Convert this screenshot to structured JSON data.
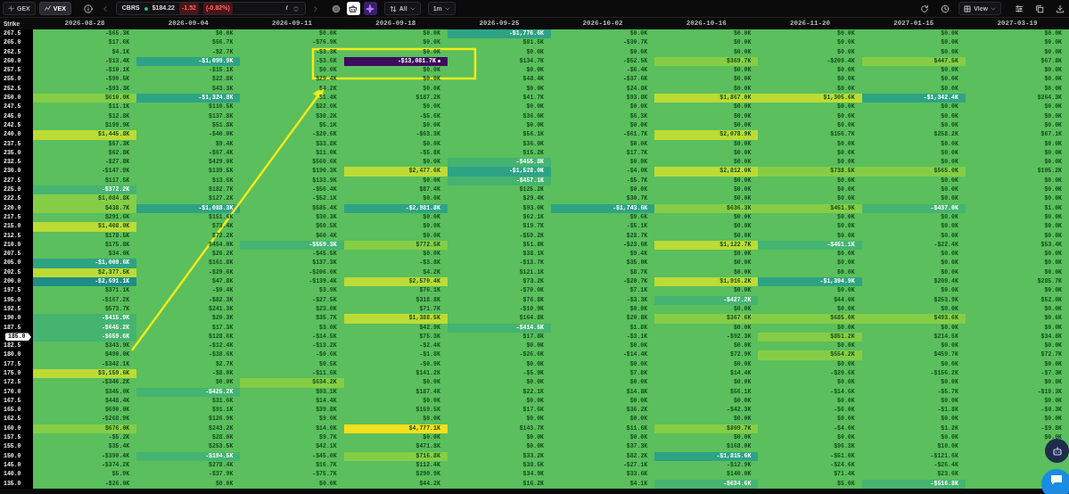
{
  "toolbar": {
    "modes": [
      {
        "label": "GEX",
        "selected": false
      },
      {
        "label": "VEX",
        "selected": true
      }
    ],
    "ticker": {
      "symbol": "CBRS",
      "price": "$184.22",
      "change": "-1.52",
      "change_pct": "(-0.82%)",
      "separator": "/"
    },
    "filter": "All",
    "interval": "1m",
    "view": "View"
  },
  "table": {
    "strike_header": "Strike",
    "strikes": [
      {
        "label": "267.5",
        "current": false
      },
      {
        "label": "265.0",
        "current": false
      },
      {
        "label": "262.5",
        "current": false
      },
      {
        "label": "260.0",
        "current": false
      },
      {
        "label": "257.5",
        "current": false
      },
      {
        "label": "255.0",
        "current": false
      },
      {
        "label": "252.5",
        "current": false
      },
      {
        "label": "250.0",
        "current": false
      },
      {
        "label": "247.5",
        "current": false
      },
      {
        "label": "245.0",
        "current": false
      },
      {
        "label": "242.5",
        "current": false
      },
      {
        "label": "240.0",
        "current": false
      },
      {
        "label": "237.5",
        "current": false
      },
      {
        "label": "235.0",
        "current": false
      },
      {
        "label": "232.5",
        "current": false
      },
      {
        "label": "230.0",
        "current": false
      },
      {
        "label": "227.5",
        "current": false
      },
      {
        "label": "225.0",
        "current": false
      },
      {
        "label": "222.5",
        "current": false
      },
      {
        "label": "220.0",
        "current": false
      },
      {
        "label": "217.5",
        "current": false
      },
      {
        "label": "215.0",
        "current": false
      },
      {
        "label": "212.5",
        "current": false
      },
      {
        "label": "210.0",
        "current": false
      },
      {
        "label": "207.5",
        "current": false
      },
      {
        "label": "205.0",
        "current": false
      },
      {
        "label": "202.5",
        "current": false
      },
      {
        "label": "200.0",
        "current": false
      },
      {
        "label": "197.5",
        "current": false
      },
      {
        "label": "195.0",
        "current": false
      },
      {
        "label": "192.5",
        "current": false
      },
      {
        "label": "190.0",
        "current": false
      },
      {
        "label": "187.5",
        "current": false
      },
      {
        "label": "185.0",
        "current": true
      },
      {
        "label": "182.5",
        "current": false
      },
      {
        "label": "180.0",
        "current": false
      },
      {
        "label": "177.5",
        "current": false
      },
      {
        "label": "175.0",
        "current": false
      },
      {
        "label": "172.5",
        "current": false
      },
      {
        "label": "170.0",
        "current": false
      },
      {
        "label": "167.5",
        "current": false
      },
      {
        "label": "165.0",
        "current": false
      },
      {
        "label": "162.5",
        "current": false
      },
      {
        "label": "160.0",
        "current": false
      },
      {
        "label": "157.5",
        "current": false
      },
      {
        "label": "155.0",
        "current": false
      },
      {
        "label": "150.0",
        "current": false
      },
      {
        "label": "145.0",
        "current": false
      },
      {
        "label": "140.0",
        "current": false
      },
      {
        "label": "135.0",
        "current": false
      }
    ],
    "columns": [
      {
        "date": "2026-08-28",
        "cells": [
          "-$65.3K",
          "$17.6K",
          "$4.1K",
          "-$13.4K",
          "-$10.1K",
          "-$90.5K",
          "-$93.3K",
          {
            "text": "$610.0K",
            "color": "#86cd46"
          },
          "$11.1K",
          "$12.8K",
          "$199.9K",
          {
            "text": "$1,445.8K",
            "color": "#bcdb35"
          },
          "$57.3K",
          "$62.8K",
          "-$27.8K",
          "-$147.9K",
          "$117.5K",
          {
            "text": "-$372.2K",
            "color": "#45b471"
          },
          {
            "text": "$1,084.8K",
            "color": "#86cd46"
          },
          {
            "text": "$438.7K",
            "color": "#86cd46"
          },
          "$291.6K",
          {
            "text": "$1,408.0K",
            "color": "#bcdb35"
          },
          "$178.5K",
          "$175.8K",
          "$34.0K",
          {
            "text": "-$1,009.6K",
            "color": "#2ea384"
          },
          {
            "text": "$2,377.5K",
            "color": "#bcdb35"
          },
          {
            "text": "-$2,691.1K",
            "color": "#1e8d86"
          },
          "$371.1K",
          "-$167.2K",
          "$573.7K",
          {
            "text": "-$415.9K",
            "color": "#45b471"
          },
          {
            "text": "-$645.2K",
            "color": "#45b471"
          },
          {
            "text": "-$659.6K",
            "color": "#45b471"
          },
          "$343.9K",
          "$490.0K",
          "-$342.1K",
          {
            "text": "$3,159.6K",
            "color": "#bcdb35"
          },
          "-$346.2K",
          "$345.0K",
          "$448.4K",
          "$690.0K",
          "-$268.9K",
          {
            "text": "$676.0K",
            "color": "#86cd46"
          },
          "-$5.2K",
          "$35.4K",
          "-$390.4K",
          "-$374.2K",
          "$5.9K",
          "-$26.0K"
        ]
      },
      {
        "date": "2026-09-04",
        "cells": [
          "$0.0K",
          "$56.7K",
          "-$2.7K",
          {
            "text": "-$1,099.9K",
            "color": "#2ea384"
          },
          "-$15.1K",
          "$22.8K",
          "$43.3K",
          {
            "text": "-$1,324.8K",
            "color": "#2ea384"
          },
          "$110.5K",
          "$137.8K",
          "$51.8K",
          "-$40.0K",
          "$9.4K",
          "-$67.4K",
          "$429.0K",
          "$139.5K",
          "$13.6K",
          "$182.7K",
          "$127.2K",
          {
            "text": "-$1,088.3K",
            "color": "#2ea384"
          },
          "$151.6K",
          "$73.4K",
          "$72.2K",
          "$454.0K",
          "$26.2K",
          "$161.8K",
          "-$29.6K",
          "$47.8K",
          "-$9.4K",
          "-$82.3K",
          "$241.3K",
          "$20.3K",
          "$17.3K",
          "$128.6K",
          "-$12.4K",
          "-$38.6K",
          "$2.7K",
          "-$8.0K",
          "$0.0K",
          {
            "text": "-$425.2K",
            "color": "#45b471"
          },
          "$31.6K",
          "$91.1K",
          "$126.9K",
          "$243.2K",
          "$28.0K",
          "$253.5K",
          {
            "text": "-$194.5K",
            "color": "#45b471"
          },
          "$278.4K",
          "-$37.9K",
          "$0.0K"
        ]
      },
      {
        "date": "2026-09-11",
        "cells": [
          "$0.0K",
          "-$76.9K",
          "-$3.3K",
          "-$3.6K",
          "$0.0K",
          "$29.4K",
          "$4.2K",
          "$1.4K",
          "$22.0K",
          "$30.2K",
          "$5.1K",
          "-$20.6K",
          "$33.8K",
          "$11.0K",
          "$560.6K",
          "$190.3K",
          "$133.9K",
          "-$56.4K",
          "-$52.1K",
          "$585.4K",
          "$30.3K",
          "$60.5K",
          "$60.4K",
          {
            "text": "-$559.3K",
            "color": "#45b471"
          },
          "-$45.5K",
          "$137.3K",
          "-$206.0K",
          "-$139.4K",
          "$3.9K",
          "-$27.5K",
          "$23.0K",
          "$35.7K",
          "$3.0K",
          "-$14.5K",
          "-$13.2K",
          "-$0.6K",
          "$0.5K",
          "-$11.6K",
          {
            "text": "$634.2K",
            "color": "#86cd46"
          },
          "$93.1K",
          "$14.4K",
          "$39.8K",
          "$9.0K",
          "$14.0K",
          "$9.7K",
          "$42.1K",
          "-$45.0K",
          "$16.7K",
          "-$75.7K",
          "$0.0K"
        ]
      },
      {
        "date": "2026-09-18",
        "cells": [
          "$0.0K",
          "$0.0K",
          "$0.0K",
          {
            "text": "-$13,081.7K",
            "color": "#3e0b5e",
            "marked": true
          },
          "$0.0K",
          "$0.0K",
          "$0.0K",
          "$187.2K",
          "$0.0K",
          "-$5.6K",
          "$0.0K",
          "-$63.3K",
          "$0.0K",
          "-$5.8K",
          "$0.0K",
          {
            "text": "$2,477.6K",
            "color": "#bcdb35"
          },
          "$0.0K",
          "$87.4K",
          "$0.0K",
          {
            "text": "-$2,981.8K",
            "color": "#2ea384"
          },
          "$0.0K",
          "$0.0K",
          "$0.0K",
          {
            "text": "$772.5K",
            "color": "#86cd46"
          },
          "$0.0K",
          "-$3.8K",
          "$4.2K",
          {
            "text": "$2,570.4K",
            "color": "#bcdb35"
          },
          "$76.1K",
          "$318.8K",
          "$71.7K",
          {
            "text": "$1,388.5K",
            "color": "#bcdb35"
          },
          "$42.9K",
          "$75.3K",
          "-$2.4K",
          "-$1.8K",
          "-$0.9K",
          "$141.2K",
          "$0.0K",
          "$187.4K",
          "$0.0K",
          "$159.5K",
          "$0.0K",
          {
            "text": "$4,777.1K",
            "color": "#f5e01c"
          },
          "$0.0K",
          "$471.8K",
          {
            "text": "$716.8K",
            "color": "#86cd46"
          },
          "$112.4K",
          "$290.9K",
          "$44.2K"
        ]
      },
      {
        "date": "2026-09-25",
        "cells": [
          {
            "text": "-$1,776.6K",
            "color": "#2ea384"
          },
          "$81.5K",
          "$0.0K",
          "$134.7K",
          "$0.0K",
          "$48.4K",
          "$0.0K",
          "$41.7K",
          "$0.0K",
          "$36.0K",
          "$0.0K",
          "$56.1K",
          "$36.0K",
          "$15.2K",
          {
            "text": "-$455.8K",
            "color": "#45b471"
          },
          {
            "text": "-$1,528.0K",
            "color": "#2ea384"
          },
          {
            "text": "-$457.1K",
            "color": "#45b471"
          },
          "$125.2K",
          "$29.4K",
          "$93.0K",
          "$62.1K",
          "$19.7K",
          "-$59.2K",
          "$51.8K",
          "$38.1K",
          "-$13.7K",
          "$121.1K",
          "$73.2K",
          "-$70.0K",
          "$76.8K",
          "-$10.9K",
          "$164.8K",
          {
            "text": "-$414.5K",
            "color": "#45b471"
          },
          "$17.8K",
          "$0.0K",
          "-$26.6K",
          "$0.0K",
          "-$5.9K",
          "$0.0K",
          "$22.1K",
          "$0.0K",
          "$17.6K",
          "$0.0K",
          "$143.7K",
          "$0.0K",
          "$0.0K",
          "$33.2K",
          "$38.5K",
          "$34.9K",
          "$16.2K"
        ]
      },
      {
        "date": "2026-10-02",
        "cells": [
          "$0.0K",
          "-$30.7K",
          "$0.0K",
          "-$52.5K",
          "-$6.4K",
          "-$37.6K",
          "$24.8K",
          "$93.8K",
          "$0.0K",
          "$6.3K",
          "$0.0K",
          "-$61.7K",
          "$0.0K",
          "$17.7K",
          "$0.0K",
          "-$4.0K",
          "-$5.7K",
          "$0.0K",
          "$30.7K",
          {
            "text": "-$1,743.6K",
            "color": "#2ea384"
          },
          "$9.6K",
          "-$5.1K",
          "$28.7K",
          "-$23.6K",
          "$9.4K",
          "$35.0K",
          "$8.7K",
          "-$20.7K",
          "$7.1K",
          "-$3.3K",
          "$0.0K",
          "$20.8K",
          "$1.8K",
          "-$3.1K",
          "$0.0K",
          "-$14.4K",
          "$0.0K",
          "$7.8K",
          "$0.0K",
          "$14.8K",
          "$0.0K",
          "$36.2K",
          "$0.0K",
          "$11.6K",
          "$0.0K",
          "$37.3K",
          "$82.2K",
          "-$27.1K",
          "$33.6K",
          "$4.1K"
        ]
      },
      {
        "date": "2026-10-16",
        "cells": [
          "$0.0K",
          "$0.0K",
          "$0.0K",
          {
            "text": "$369.7K",
            "color": "#86cd46"
          },
          "$0.0K",
          "$0.0K",
          "$0.0K",
          {
            "text": "$1,867.0K",
            "color": "#bcdb35"
          },
          "$0.0K",
          "$0.0K",
          "$0.0K",
          {
            "text": "$2,078.9K",
            "color": "#bcdb35"
          },
          "$0.0K",
          "$0.0K",
          "$0.0K",
          {
            "text": "$2,812.0K",
            "color": "#bcdb35"
          },
          "$0.0K",
          "$0.0K",
          "$0.0K",
          {
            "text": "$636.3K",
            "color": "#86cd46"
          },
          "$0.0K",
          "$0.0K",
          "$0.0K",
          {
            "text": "$1,122.7K",
            "color": "#bcdb35"
          },
          "$0.0K",
          "$0.0K",
          "$0.0K",
          {
            "text": "$1,916.2K",
            "color": "#bcdb35"
          },
          "$0.0K",
          {
            "text": "-$427.2K",
            "color": "#45b471"
          },
          "$0.0K",
          {
            "text": "$367.6K",
            "color": "#86cd46"
          },
          "$0.0K",
          "-$92.3K",
          "$0.0K",
          "$72.9K",
          "$0.0K",
          "$14.4K",
          "$0.0K",
          "$56.1K",
          "$0.0K",
          "-$42.3K",
          "$0.0K",
          {
            "text": "$809.7K",
            "color": "#86cd46"
          },
          "$0.0K",
          "$168.0K",
          {
            "text": "-$1,815.6K",
            "color": "#2ea384"
          },
          "-$12.9K",
          "$140.0K",
          {
            "text": "-$634.6K",
            "color": "#45b471"
          }
        ]
      },
      {
        "date": "2026-11-20",
        "cells": [
          "$0.0K",
          "$0.0K",
          "$0.0K",
          "-$209.4K",
          "$0.0K",
          "$0.0K",
          "$0.0K",
          {
            "text": "$1,305.6K",
            "color": "#bcdb35"
          },
          "$0.0K",
          "$0.0K",
          "$0.0K",
          "$156.7K",
          "$0.0K",
          "$0.0K",
          "$0.0K",
          {
            "text": "$738.5K",
            "color": "#86cd46"
          },
          "$0.0K",
          "$0.0K",
          "$0.0K",
          {
            "text": "$451.9K",
            "color": "#86cd46"
          },
          "$0.0K",
          "$0.0K",
          "$0.0K",
          {
            "text": "-$451.1K",
            "color": "#45b471"
          },
          "$0.0K",
          "$0.0K",
          "$0.0K",
          {
            "text": "-$1,394.9K",
            "color": "#2ea384"
          },
          "$0.0K",
          "$44.0K",
          "$0.0K",
          {
            "text": "$685.0K",
            "color": "#86cd46"
          },
          "$0.0K",
          {
            "text": "$851.2K",
            "color": "#86cd46"
          },
          "$0.0K",
          {
            "text": "$554.2K",
            "color": "#86cd46"
          },
          "$0.0K",
          "-$20.6K",
          "$0.0K",
          "-$14.6K",
          "$0.0K",
          "-$6.0K",
          "$0.0K",
          "-$4.0K",
          "$0.0K",
          "$96.3K",
          "-$51.0K",
          "-$24.6K",
          "$71.4K",
          "$5.0K"
        ]
      },
      {
        "date": "2027-01-15",
        "cells": [
          "$0.0K",
          "$0.0K",
          "$0.0K",
          {
            "text": "$447.5K",
            "color": "#86cd46"
          },
          "$0.0K",
          "$0.0K",
          "$0.0K",
          {
            "text": "-$1,342.4K",
            "color": "#2ea384"
          },
          "$0.0K",
          "$0.0K",
          "$0.0K",
          "$258.2K",
          "$0.0K",
          "$0.0K",
          "$0.0K",
          {
            "text": "$565.0K",
            "color": "#86cd46"
          },
          "$0.0K",
          "$0.0K",
          "$0.0K",
          {
            "text": "-$437.0K",
            "color": "#45b471"
          },
          "$0.0K",
          "$0.0K",
          "$0.0K",
          "-$22.4K",
          "$0.0K",
          "$0.0K",
          "$0.0K",
          "$209.4K",
          "$0.0K",
          "$253.9K",
          "$0.0K",
          {
            "text": "$493.6K",
            "color": "#86cd46"
          },
          "$0.0K",
          "$214.5K",
          "$0.0K",
          "$459.7K",
          "$0.0K",
          "-$156.2K",
          "$0.0K",
          "-$5.7K",
          "$0.0K",
          "-$1.8K",
          "$0.0K",
          "$1.2K",
          "$0.0K",
          "$10.0K",
          "-$121.6K",
          "-$26.4K",
          "$23.6K",
          {
            "text": "-$516.8K",
            "color": "#45b471"
          }
        ]
      },
      {
        "date": "2027-03-19",
        "cells": [
          "$0.0K",
          "$0.0K",
          "$0.0K",
          "$67.8K",
          "$0.0K",
          "$0.0K",
          "$0.0K",
          "$264.3K",
          "$0.0K",
          "$0.0K",
          "$0.0K",
          "$67.1K",
          "$0.0K",
          "$0.0K",
          "$0.0K",
          "$105.2K",
          "$0.0K",
          "$0.0K",
          "$0.0K",
          "$1.0K",
          "$0.0K",
          "$0.0K",
          "$0.0K",
          "$53.4K",
          "$0.0K",
          "$0.0K",
          "$0.0K",
          "$285.7K",
          "$0.0K",
          "$52.0K",
          "$0.0K",
          "$0.6K",
          "$0.0K",
          "$34.8K",
          "$0.0K",
          "$72.7K",
          "$0.0K",
          "-$7.3K",
          "$0.0K",
          "-$19.3K",
          "$0.0K",
          "-$0.3K",
          "$0.0K",
          "-$9.8K",
          "$0.0K",
          null,
          null,
          null,
          null,
          null
        ]
      }
    ]
  }
}
